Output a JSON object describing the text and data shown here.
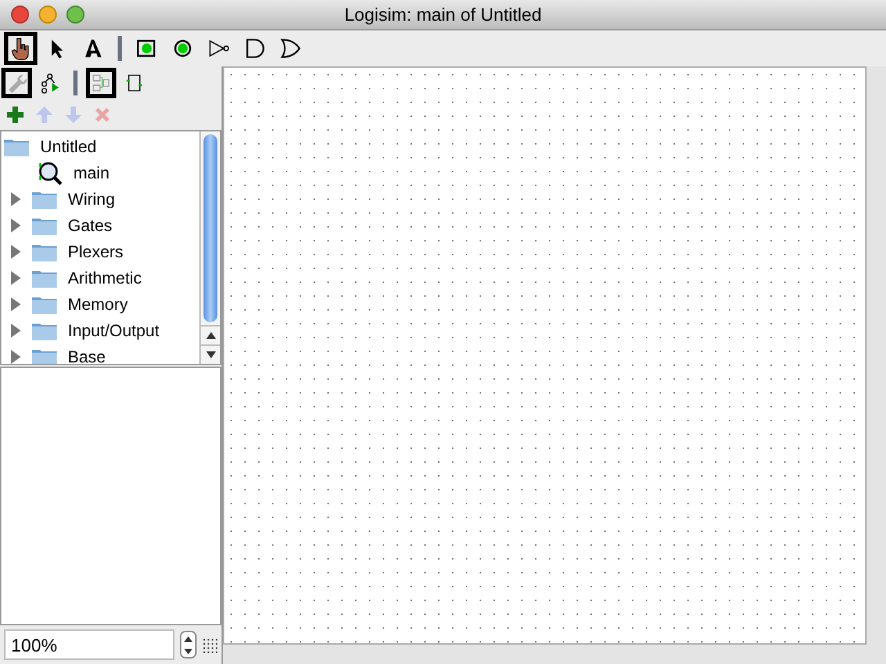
{
  "window": {
    "title": "Logisim: main of Untitled"
  },
  "toolbar": [
    {
      "kind": "poke",
      "selected": true
    },
    {
      "kind": "select",
      "selected": false
    },
    {
      "kind": "text",
      "selected": false
    },
    {
      "kind": "sep"
    },
    {
      "kind": "pin-in",
      "selected": false
    },
    {
      "kind": "pin-out",
      "selected": false
    },
    {
      "kind": "not",
      "selected": false
    },
    {
      "kind": "and",
      "selected": false
    },
    {
      "kind": "or",
      "selected": false
    }
  ],
  "project_tools": [
    {
      "kind": "wrench",
      "selected": true
    },
    {
      "kind": "tree",
      "selected": false
    },
    {
      "kind": "sep"
    },
    {
      "kind": "layout",
      "selected": true
    },
    {
      "kind": "appearance",
      "selected": false
    }
  ],
  "edit_tools": [
    {
      "kind": "add",
      "disabled": false
    },
    {
      "kind": "up",
      "disabled": true
    },
    {
      "kind": "down",
      "disabled": true
    },
    {
      "kind": "delete",
      "disabled": true
    }
  ],
  "tree": [
    {
      "label": "Untitled",
      "kind": "folder",
      "children": [
        {
          "label": "main",
          "kind": "circuit"
        },
        {
          "label": "Wiring",
          "kind": "folder",
          "expanded": false
        },
        {
          "label": "Gates",
          "kind": "folder",
          "expanded": false
        },
        {
          "label": "Plexers",
          "kind": "folder",
          "expanded": false
        },
        {
          "label": "Arithmetic",
          "kind": "folder",
          "expanded": false
        },
        {
          "label": "Memory",
          "kind": "folder",
          "expanded": false
        },
        {
          "label": "Input/Output",
          "kind": "folder",
          "expanded": false
        },
        {
          "label": "Base",
          "kind": "folder",
          "expanded": false
        }
      ]
    }
  ],
  "zoom": {
    "value": "100%"
  }
}
